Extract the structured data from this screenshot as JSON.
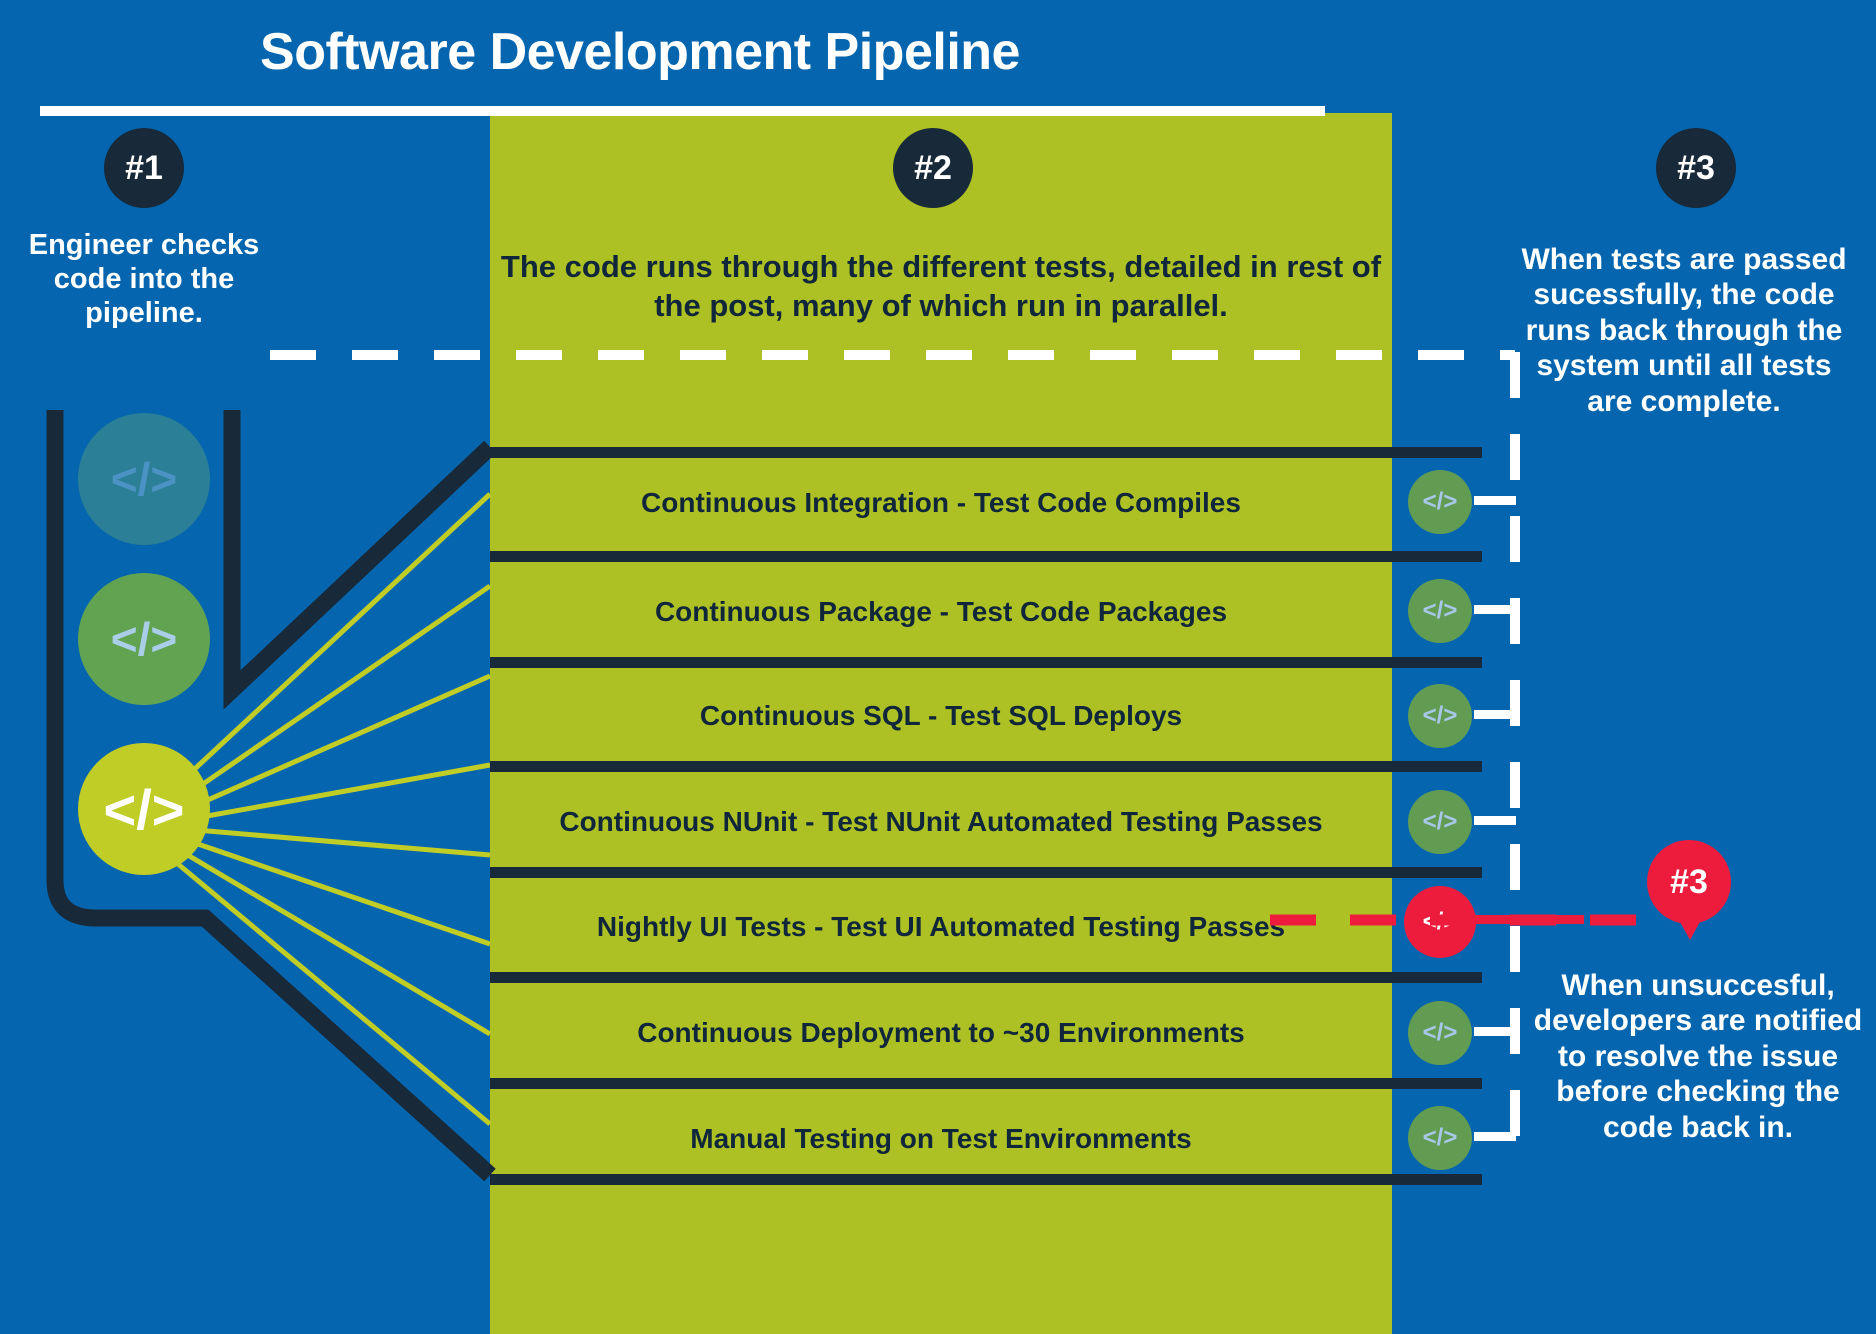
{
  "header": {
    "title": "Software Development Pipeline"
  },
  "steps": [
    {
      "badge": "#1",
      "text": "Engineer checks code into the pipeline."
    },
    {
      "badge": "#2",
      "text": "The code runs through the different tests, detailed in rest of the post, many of which run in parallel."
    },
    {
      "badge": "#3",
      "text": "When tests are passed sucessfully, the code runs back through the system until all tests are complete."
    }
  ],
  "failure": {
    "badge": "#3",
    "text": "When unsuccesful, developers are notified to resolve the issue before checking the code back in."
  },
  "pipeline_stages": [
    {
      "label": "Continuous Integration - Test Code Compiles",
      "status": "pass"
    },
    {
      "label": "Continuous Package - Test Code Packages",
      "status": "pass"
    },
    {
      "label": "Continuous SQL - Test SQL Deploys",
      "status": "pass"
    },
    {
      "label": "Continuous NUnit - Test NUnit Automated Testing Passes",
      "status": "pass"
    },
    {
      "label": "Nightly UI Tests - Test UI Automated Testing Passes",
      "status": "fail"
    },
    {
      "label": "Continuous Deployment to ~30 Environments",
      "status": "pass"
    },
    {
      "label": "Manual Testing on Test Environments",
      "status": "pass"
    }
  ],
  "icons": {
    "code_glyph": "</>",
    "left_code_icons": [
      "code-icon-teal",
      "code-icon-green",
      "code-icon-lime"
    ],
    "right_status_icon": "code-icon-status"
  },
  "colors": {
    "background_blue": "#0566af",
    "panel_green": "#aec124",
    "dark_navy": "#18293a",
    "fail_red": "#ed1b3c",
    "pass_green": "#629b52",
    "white": "#ffffff"
  }
}
